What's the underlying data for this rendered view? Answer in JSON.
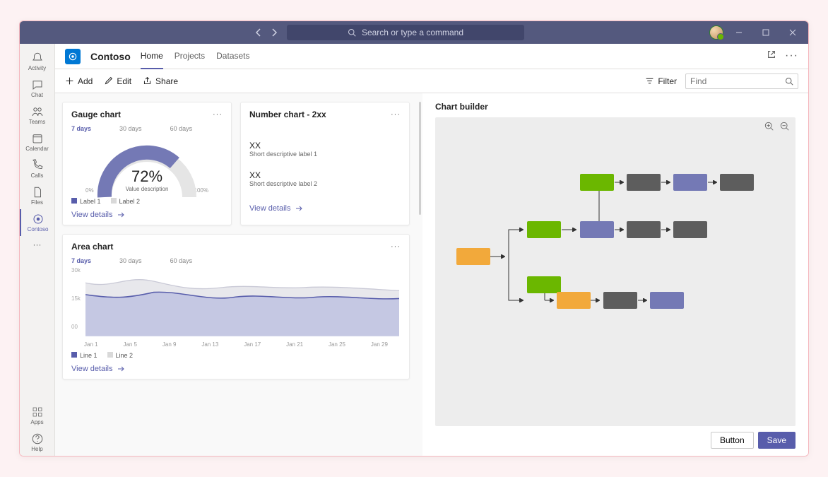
{
  "search_placeholder": "Search or type a command",
  "rail": {
    "items": [
      "Activity",
      "Chat",
      "Teams",
      "Calendar",
      "Calls",
      "Files",
      "Contoso"
    ],
    "more": "···",
    "bottom": [
      "Apps",
      "Help"
    ]
  },
  "app": {
    "name": "Contoso",
    "tabs": [
      "Home",
      "Projects",
      "Datasets"
    ]
  },
  "toolbar": {
    "add": "Add",
    "edit": "Edit",
    "share": "Share",
    "filter": "Filter",
    "find_placeholder": "Find"
  },
  "gauge_card": {
    "title": "Gauge chart",
    "ranges": [
      "7 days",
      "30 days",
      "60 days"
    ],
    "min": "0%",
    "max": "100%",
    "legend": [
      "Label 1",
      "Label 2"
    ],
    "details": "View details"
  },
  "number_card": {
    "title": "Number chart - 2xx",
    "rows": [
      {
        "v": "XX",
        "l": "Short descriptive label 1"
      },
      {
        "v": "XX",
        "l": "Short descriptive label 2"
      }
    ],
    "details": "View details"
  },
  "area_card": {
    "title": "Area chart",
    "ranges": [
      "7 days",
      "30 days",
      "60 days"
    ],
    "legend": [
      "Line 1",
      "Line 2"
    ],
    "details": "View details"
  },
  "builder": {
    "title": "Chart builder",
    "button": "Button",
    "save": "Save"
  },
  "chart_data": [
    {
      "type": "gauge",
      "title": "Gauge chart",
      "value_pct": 72,
      "value_desc": "Value description",
      "min": 0,
      "max": 100,
      "series": [
        {
          "name": "Label 1",
          "color": "#585DAB"
        },
        {
          "name": "Label 2",
          "color": "#D9D9D9"
        }
      ]
    },
    {
      "type": "area",
      "title": "Area chart",
      "ylabels": [
        "30k",
        "15k",
        "00"
      ],
      "ylim": [
        0,
        30000
      ],
      "x": [
        "Jan 1",
        "Jan 5",
        "Jan 9",
        "Jan 13",
        "Jan 17",
        "Jan 21",
        "Jan 25",
        "Jan 29"
      ],
      "series": [
        {
          "name": "Line 1",
          "color": "#585DAB",
          "values": [
            19000,
            17500,
            20000,
            18500,
            19500,
            18000,
            19500,
            18500
          ]
        },
        {
          "name": "Line 2",
          "color": "#D9D9D9",
          "values": [
            24000,
            22000,
            27000,
            21000,
            24000,
            22000,
            22500,
            21000
          ]
        }
      ]
    }
  ]
}
